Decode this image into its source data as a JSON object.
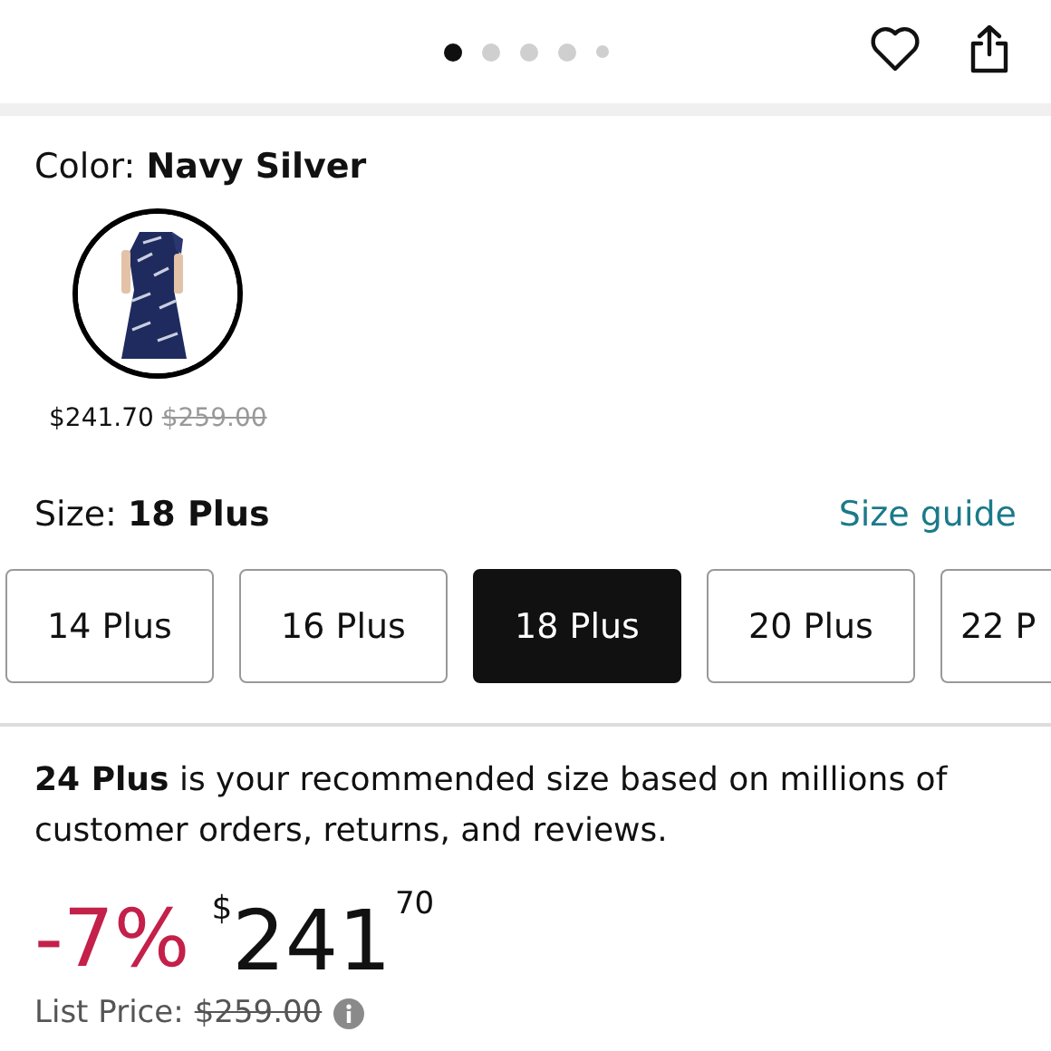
{
  "carousel": {
    "dots": [
      {
        "selected": true
      },
      {
        "selected": false
      },
      {
        "selected": false
      },
      {
        "selected": false
      },
      {
        "selected": false
      }
    ]
  },
  "color": {
    "label": "Color:",
    "value": "Navy Silver",
    "swatches": [
      {
        "kind": "picture",
        "selected": true,
        "price": "$241.70",
        "list_price": "$259.00"
      }
    ]
  },
  "size": {
    "label": "Size:",
    "value": "18 Plus",
    "guide_link": "Size guide",
    "options": [
      {
        "label": "14 Plus",
        "selected": false
      },
      {
        "label": "16 Plus",
        "selected": false
      },
      {
        "label": "18 Plus",
        "selected": true
      },
      {
        "label": "20 Plus",
        "selected": false
      },
      {
        "label": "22 P",
        "selected": false
      }
    ]
  },
  "recommendation": "**24 Plus** is your recommended size based on millions of customer orders, returns, and reviews.",
  "price": {
    "discount": "-7%",
    "currency": "$",
    "whole": "241",
    "fraction": "70",
    "list_label": "List Price:",
    "list_price": "$259.00"
  }
}
